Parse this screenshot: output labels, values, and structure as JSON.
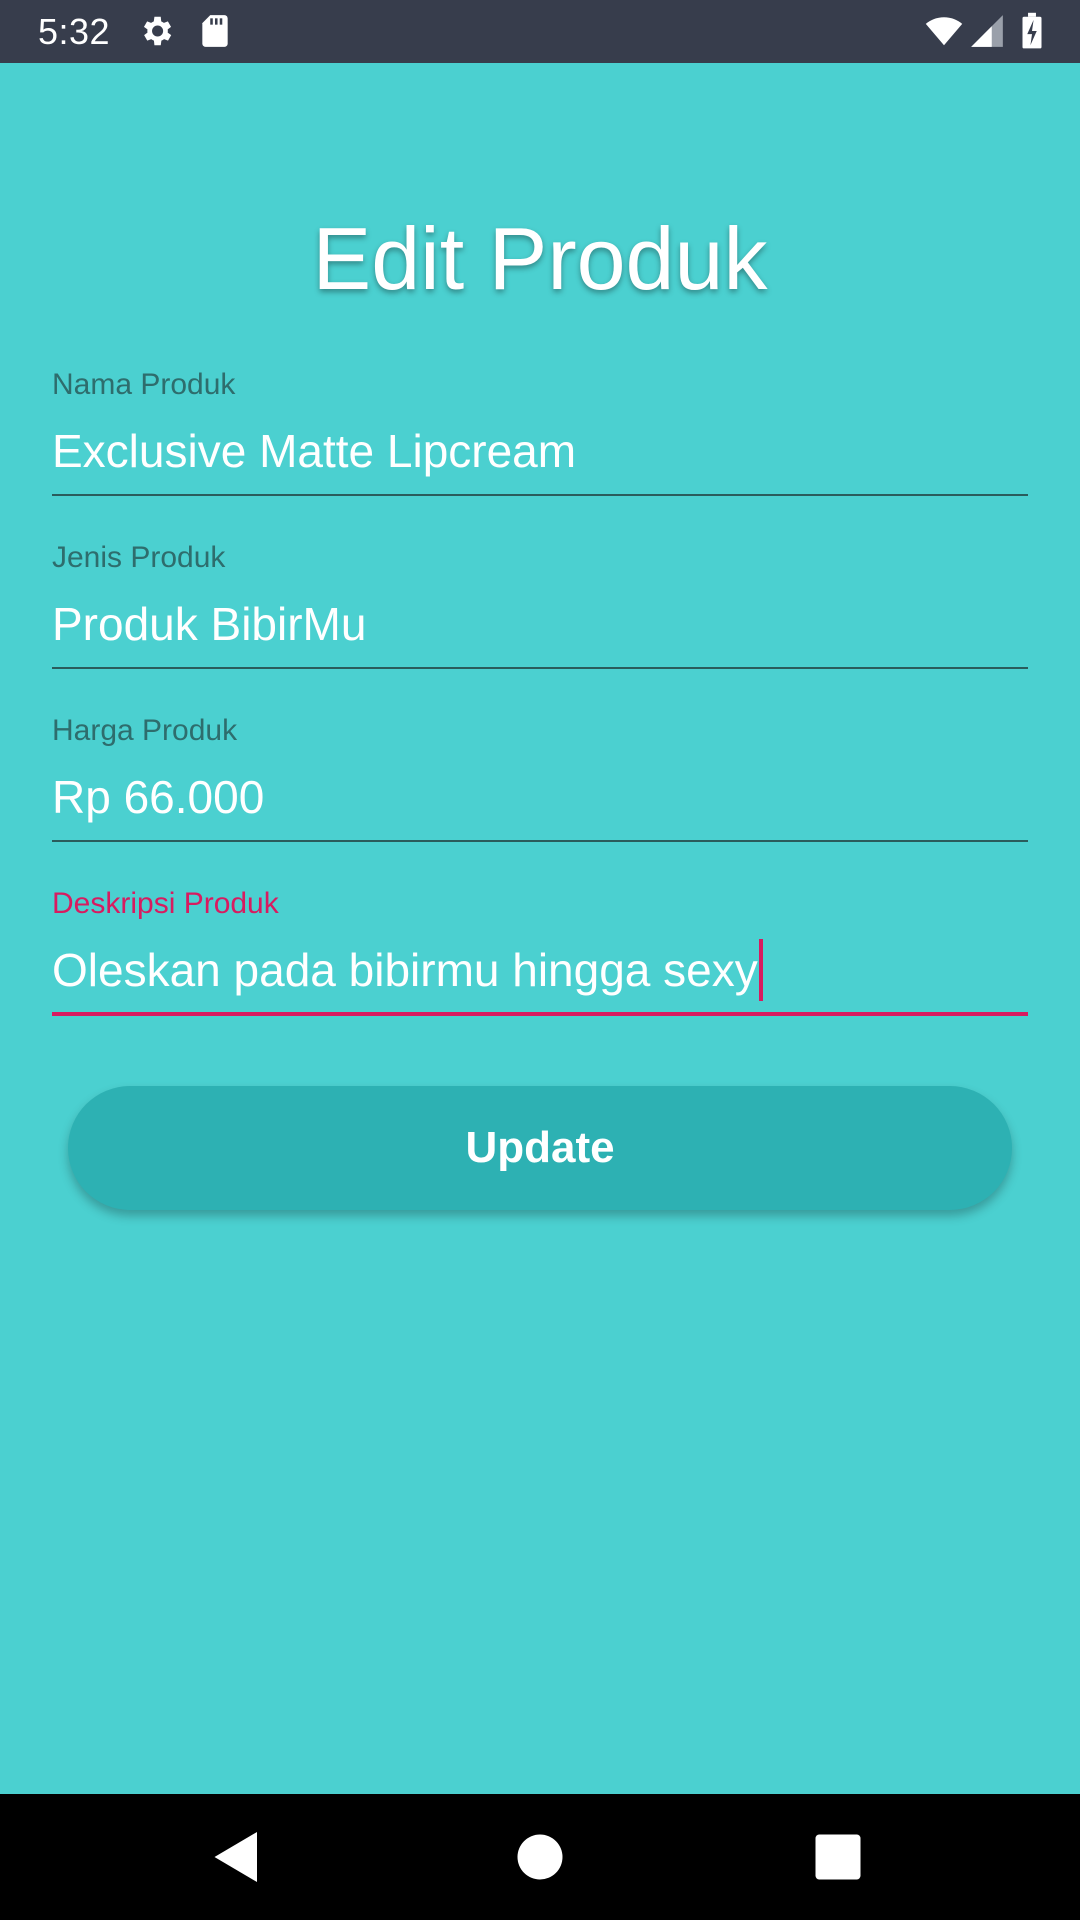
{
  "status_bar": {
    "time": "5:32",
    "icons": [
      "gear-icon",
      "sd-card-icon",
      "wifi-icon",
      "cell-signal-icon",
      "battery-charging-icon"
    ]
  },
  "title": "Edit Produk",
  "fields": [
    {
      "label": "Nama Produk",
      "value": "Exclusive Matte Lipcream"
    },
    {
      "label": "Jenis Produk",
      "value": "Produk BibirMu"
    },
    {
      "label": "Harga Produk",
      "value": "Rp 66.000"
    },
    {
      "label": "Deskripsi Produk",
      "value": "Oleskan pada bibirmu hingga sexy"
    }
  ],
  "update_button": {
    "label": "Update"
  },
  "nav_bar": {
    "icons": [
      "back-icon",
      "home-icon",
      "recents-icon"
    ]
  },
  "colors": {
    "background": "#4bd0d0",
    "status_bar": "#373d4c",
    "accent": "#d81b60",
    "button": "#2db1b3"
  }
}
